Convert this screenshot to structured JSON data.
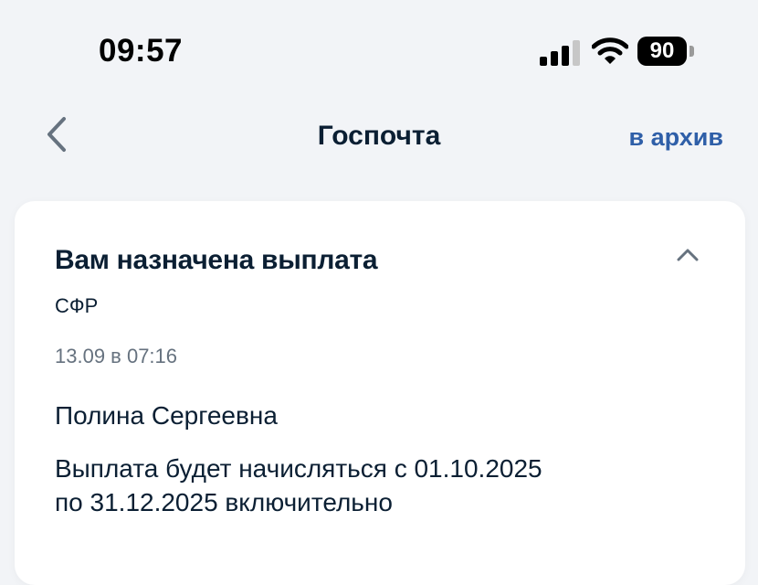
{
  "status_bar": {
    "time": "09:57",
    "battery_level": "90",
    "signal_icon": "cellular-signal-icon",
    "wifi_icon": "wifi-icon",
    "battery_icon": "battery-icon"
  },
  "nav": {
    "back_icon": "chevron-left-icon",
    "title": "Госпочта",
    "action_label": "в архив"
  },
  "message": {
    "title": "Вам назначена выплата",
    "sender": "СФР",
    "date": "13.09 в 07:16",
    "greeting": "Полина Сергеевна",
    "body_line1": "Выплата будет начисляться с 01.10.2025",
    "body_line2": "по 31.12.2025 включительно",
    "collapse_icon": "chevron-up-icon"
  },
  "colors": {
    "background": "#f2f4f7",
    "card": "#ffffff",
    "text_primary": "#0b1f33",
    "text_secondary": "#66727f",
    "accent": "#2f5fa8"
  }
}
